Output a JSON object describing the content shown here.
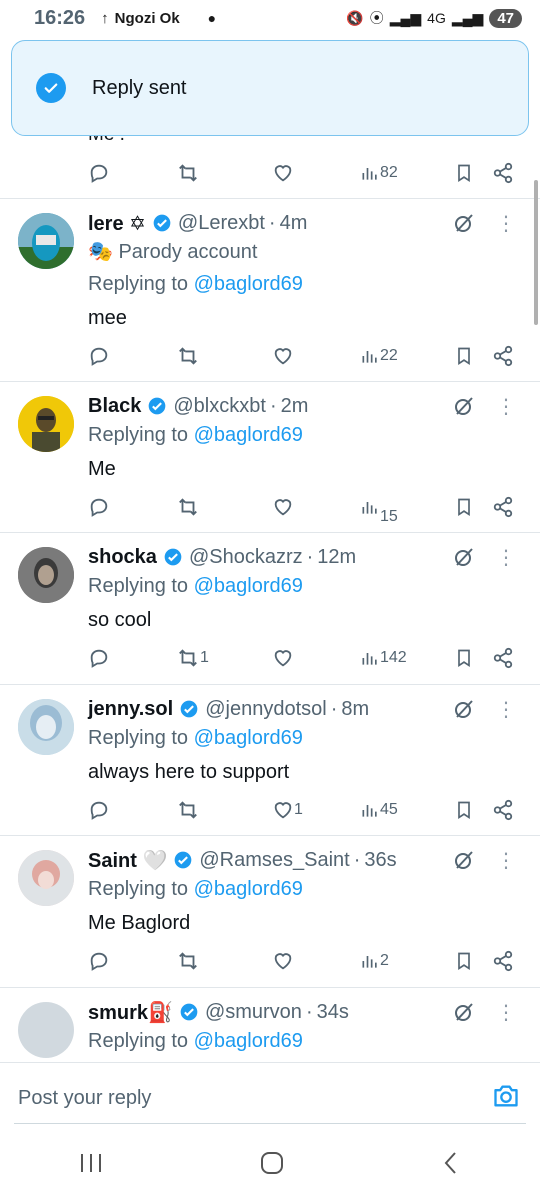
{
  "status_bar": {
    "time": "16:26",
    "carrier": "Ngozi Ok",
    "network": "4G",
    "battery": "47"
  },
  "toast": {
    "message": "Reply sent"
  },
  "partial_tweet": {
    "text": "Me .",
    "views": "82"
  },
  "tweets": [
    {
      "name": "lere ✡",
      "handle": "@Lerexbt",
      "time": "4m",
      "parody_label": "Parody account",
      "replying_prefix": "Replying to",
      "replying_to": "@baglord69",
      "text": "mee",
      "retweets": "",
      "likes": "",
      "views": "22",
      "avatar_color": "#2a8fb0"
    },
    {
      "name": "Black",
      "handle": "@blxckxbt",
      "time": "2m",
      "replying_prefix": "Replying to",
      "replying_to": "@baglord69",
      "text": "Me",
      "retweets": "",
      "likes": "",
      "views": "15",
      "avatar_color": "#e8c20c"
    },
    {
      "name": "shocka",
      "handle": "@Shockazrz",
      "time": "12m",
      "replying_prefix": "Replying to",
      "replying_to": "@baglord69",
      "text": "so cool",
      "retweets": "1",
      "likes": "",
      "views": "142",
      "avatar_color": "#6b6b6b"
    },
    {
      "name": "jenny.sol",
      "handle": "@jennydotsol",
      "time": "8m",
      "replying_prefix": "Replying to",
      "replying_to": "@baglord69",
      "text": "always here to support",
      "retweets": "",
      "likes": "1",
      "views": "45",
      "avatar_color": "#b8d4e6"
    },
    {
      "name": "Saint 🤍",
      "handle": "@Ramses_Saint",
      "time": "36s",
      "replying_prefix": "Replying to",
      "replying_to": "@baglord69",
      "text": "Me Baglord",
      "retweets": "",
      "likes": "",
      "views": "2",
      "avatar_color": "#e8c8c8"
    },
    {
      "name": "smurk⛽",
      "handle": "@smurvon",
      "time": "34s",
      "replying_prefix": "Replying to",
      "replying_to": "@baglord69",
      "avatar_color": "#d1d9df"
    }
  ],
  "reply_bar": {
    "placeholder": "Post your reply"
  },
  "colors": {
    "accent": "#1d9bf0",
    "muted": "#536471"
  }
}
